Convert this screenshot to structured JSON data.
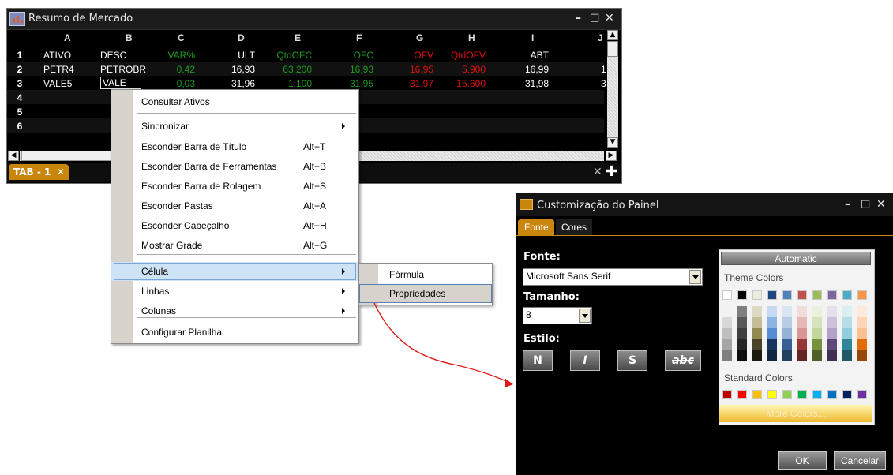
{
  "market_window": {
    "title": "Resumo de Mercado",
    "columns": [
      "A",
      "B",
      "C",
      "D",
      "E",
      "F",
      "G",
      "H",
      "I",
      "J"
    ],
    "rows": [
      {
        "n": "1",
        "cells": [
          "ATIVO",
          "DESC",
          "VAR%",
          "ULT",
          "QtdOFC",
          "OFC",
          "OFV",
          "QtdOFV",
          "ABT"
        ]
      },
      {
        "n": "2",
        "cells": [
          "PETR4",
          "PETROBR",
          "0,42",
          "16,93",
          "63.200",
          "16,93",
          "16,95",
          "5.900",
          "16,99",
          "1"
        ]
      },
      {
        "n": "3",
        "cells": [
          "VALE5",
          "VALE",
          "0,03",
          "31,96",
          "1.100",
          "31,95",
          "31,97",
          "15.600",
          "31,98",
          "3"
        ]
      },
      {
        "n": "4",
        "cells": []
      },
      {
        "n": "5",
        "cells": []
      },
      {
        "n": "6",
        "cells": []
      }
    ],
    "tab_label": "TAB - 1",
    "tab_close": "✕",
    "window_buttons": {
      "minimize": "–",
      "maximize": "□",
      "close": "✕"
    },
    "colors": {
      "green": "#1f9b1f",
      "red": "#e01010",
      "white": "#ffffff",
      "accent": "#c8860d"
    }
  },
  "context_menu": {
    "items": [
      {
        "label": "Consultar Ativos",
        "shortcut": ""
      },
      {
        "label": "Sincronizar",
        "shortcut": "",
        "submenu": true
      },
      {
        "label": "Esconder Barra de Título",
        "shortcut": "Alt+T"
      },
      {
        "label": "Esconder Barra de Ferramentas",
        "shortcut": "Alt+B"
      },
      {
        "label": "Esconder Barra de Rolagem",
        "shortcut": "Alt+S"
      },
      {
        "label": "Esconder Pastas",
        "shortcut": "Alt+A"
      },
      {
        "label": "Esconder Cabeçalho",
        "shortcut": "Alt+H"
      },
      {
        "label": "Mostrar Grade",
        "shortcut": "Alt+G"
      },
      {
        "label": "Célula",
        "shortcut": "",
        "submenu": true
      },
      {
        "label": "Linhas",
        "shortcut": "",
        "submenu": true
      },
      {
        "label": "Colunas",
        "shortcut": "",
        "submenu": true
      },
      {
        "label": "Configurar Planilha",
        "shortcut": ""
      }
    ],
    "submenu_cell": [
      "Fórmula",
      "Propriedades"
    ]
  },
  "dialog": {
    "title": "Customização do Painel",
    "tabs": [
      "Fonte",
      "Cores"
    ],
    "font_label": "Fonte:",
    "font_value": "Microsoft Sans Serif",
    "size_label": "Tamanho:",
    "size_value": "8",
    "style_label": "Estilo:",
    "style_buttons": [
      "N",
      "I",
      "S",
      "abc"
    ],
    "palette": {
      "automatic": "Automatic",
      "theme_label": "Theme Colors",
      "standard_label": "Standard Colors",
      "more": "More Colors...",
      "theme_top": [
        "#ffffff",
        "#000000",
        "#eeece1",
        "#1f497d",
        "#4f81bd",
        "#c0504d",
        "#9bbb59",
        "#8064a2",
        "#4bacc6",
        "#f79646"
      ],
      "theme_shades": [
        [
          "#f2f2f2",
          "#d8d8d8",
          "#bfbfbf",
          "#a5a5a5",
          "#7f7f7f"
        ],
        [
          "#7f7f7f",
          "#595959",
          "#3f3f3f",
          "#262626",
          "#0c0c0c"
        ],
        [
          "#ddd9c3",
          "#c4bd97",
          "#938953",
          "#494429",
          "#1d1b10"
        ],
        [
          "#c6d9f0",
          "#8db3e2",
          "#548dd4",
          "#17365d",
          "#0f243e"
        ],
        [
          "#dbe5f1",
          "#b8cce4",
          "#95b3d7",
          "#366092",
          "#244061"
        ],
        [
          "#f2dcdb",
          "#e5b9b7",
          "#d99694",
          "#953734",
          "#632423"
        ],
        [
          "#ebf1dd",
          "#d7e3bc",
          "#c3d69b",
          "#76923c",
          "#4f6128"
        ],
        [
          "#e5e0ec",
          "#ccc1d9",
          "#b2a2c7",
          "#5f497a",
          "#3f3151"
        ],
        [
          "#dbeef3",
          "#b7dde8",
          "#92cddc",
          "#31859b",
          "#205867"
        ],
        [
          "#fdeada",
          "#fbd5b5",
          "#fac08f",
          "#e36c09",
          "#974806"
        ]
      ],
      "standard": [
        "#c00000",
        "#ff0000",
        "#ffc000",
        "#ffff00",
        "#92d050",
        "#00b050",
        "#00b0f0",
        "#0070c0",
        "#002060",
        "#7030a0"
      ]
    },
    "ok": "OK",
    "cancel": "Cancelar"
  }
}
